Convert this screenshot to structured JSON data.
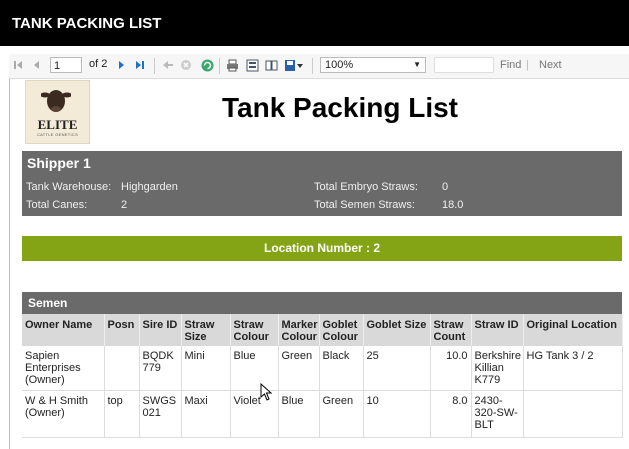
{
  "window": {
    "title": "TANK PACKING LIST"
  },
  "toolbar": {
    "page_value": "1",
    "page_of": "of 2",
    "zoom_value": "100%",
    "find_label": "Find",
    "next_label": "Next"
  },
  "logo": {
    "brand": "ELITE",
    "tagline": "CATTLE GENETICS"
  },
  "report": {
    "title": "Tank Packing List"
  },
  "shipper": {
    "name": "Shipper 1",
    "tank_warehouse_label": "Tank Warehouse:",
    "tank_warehouse_value": "Highgarden",
    "total_canes_label": "Total Canes:",
    "total_canes_value": "2",
    "total_embryo_label": "Total Embryo Straws:",
    "total_embryo_value": "0",
    "total_semen_label": "Total Semen Straws:",
    "total_semen_value": "18.0"
  },
  "location": {
    "text": "Location Number : 2"
  },
  "semen": {
    "title": "Semen",
    "headers": [
      "Owner Name",
      "Posn",
      "Sire ID",
      "Straw Size",
      "Straw Colour",
      "Marker Colour",
      "Goblet Colour",
      "Goblet Size",
      "Straw Count",
      "Straw ID",
      "Original Location"
    ],
    "rows": [
      [
        "Sapien Enterprises (Owner)",
        "",
        "BQDK 779",
        "Mini",
        "Blue",
        "Green",
        "Black",
        "25",
        "10.0",
        "Berkshire Killian K779",
        "HG Tank 3 / 2"
      ],
      [
        "W & H Smith (Owner)",
        "top",
        "SWGS 021",
        "Maxi",
        "Violet",
        "Blue",
        "Green",
        "10",
        "8.0",
        "2430-320-SW-BLT",
        ""
      ]
    ]
  },
  "colors": {
    "header_dark": "#6a6a6a",
    "location_green": "#85a415",
    "title_bar": "#000000"
  }
}
